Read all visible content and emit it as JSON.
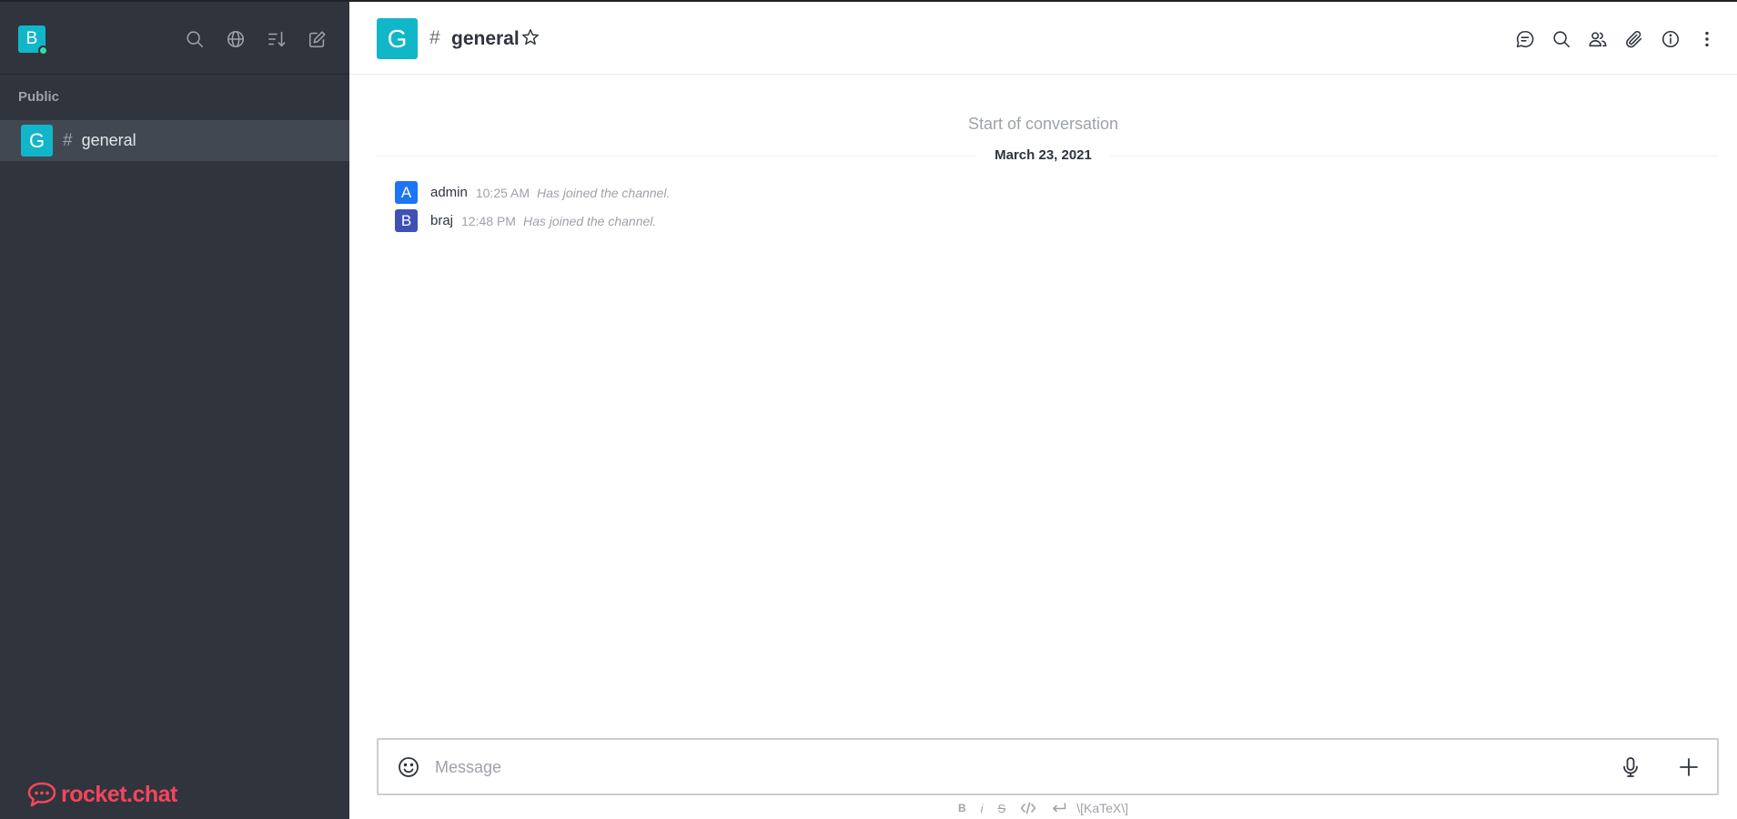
{
  "sidebar": {
    "user_initial": "B",
    "section_label": "Public",
    "rooms": [
      {
        "initial": "G",
        "name": "general"
      }
    ],
    "brand": "rocket.chat"
  },
  "header": {
    "room_initial": "G",
    "room_name": "general"
  },
  "conversation": {
    "start_label": "Start of conversation",
    "date": "March 23, 2021",
    "messages": [
      {
        "initial": "A",
        "user": "admin",
        "time": "10:25 AM",
        "text": "Has joined the channel.",
        "avatar_color": "#1d74f5"
      },
      {
        "initial": "B",
        "user": "braj",
        "time": "12:48 PM",
        "text": "Has joined the channel.",
        "avatar_color": "#3f51b5"
      }
    ]
  },
  "composer": {
    "placeholder": "Message",
    "format": {
      "bold": "B",
      "italic": "i",
      "strike": "S",
      "katex": "\\[KaTeX\\]"
    }
  },
  "colors": {
    "accent": "#12b6c9",
    "brand": "#f5455c",
    "sidebar_bg": "#2f343d"
  }
}
